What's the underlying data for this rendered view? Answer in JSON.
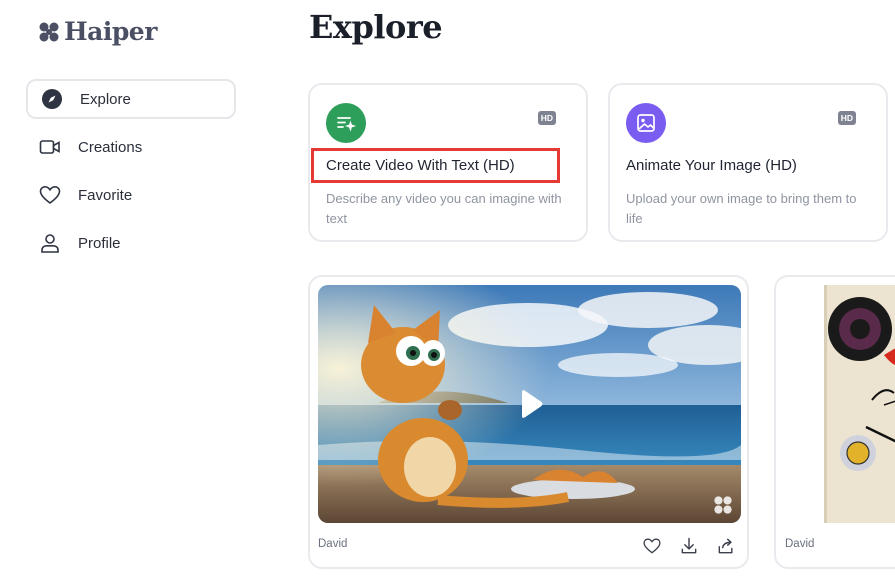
{
  "brand": {
    "name": "Haiper",
    "logo_icon": "clover-logo-icon"
  },
  "sidebar": {
    "items": [
      {
        "label": "Explore",
        "icon": "compass-icon",
        "active": true
      },
      {
        "label": "Creations",
        "icon": "video-camera-icon",
        "active": false
      },
      {
        "label": "Favorite",
        "icon": "heart-icon",
        "active": false
      },
      {
        "label": "Profile",
        "icon": "user-icon",
        "active": false
      }
    ]
  },
  "main": {
    "title": "Explore",
    "features": [
      {
        "title": "Create Video With Text (HD)",
        "description": "Describe any video you can imagine with text",
        "badge": "HD",
        "icon": "text-sparkle-icon",
        "icon_color": "#2e9e5b",
        "highlighted": true
      },
      {
        "title": "Animate Your Image (HD)",
        "description": "Upload your own image to bring them to life",
        "badge": "HD",
        "icon": "image-icon",
        "icon_color": "#7b5cf0",
        "highlighted": false
      }
    ],
    "gallery": [
      {
        "author": "David",
        "actions": [
          "heart-icon",
          "download-icon",
          "share-icon"
        ]
      },
      {
        "author": "David"
      }
    ]
  },
  "colors": {
    "accent_green": "#2e9e5b",
    "accent_purple": "#7b5cf0",
    "highlight_red": "#e53935"
  }
}
